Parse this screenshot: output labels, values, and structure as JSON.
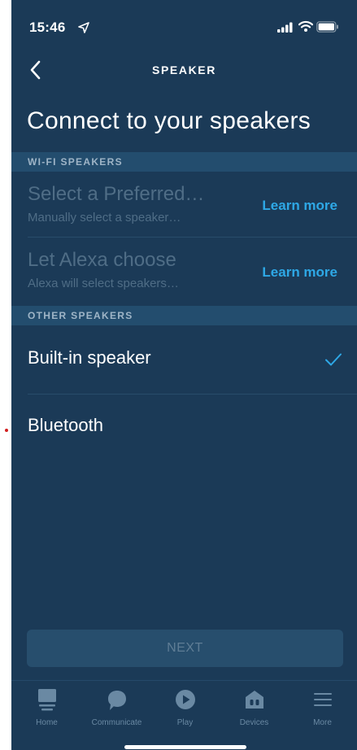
{
  "status": {
    "time": "15:46"
  },
  "header": {
    "title": "SPEAKER"
  },
  "page": {
    "title": "Connect to your speakers"
  },
  "wifi_section": {
    "label": "WI-FI SPEAKERS",
    "items": [
      {
        "title": "Select a Preferred…",
        "subtitle": "Manually select a speaker…",
        "action": "Learn more"
      },
      {
        "title": "Let Alexa choose",
        "subtitle": "Alexa will select speakers…",
        "action": "Learn more"
      }
    ]
  },
  "other_section": {
    "label": "OTHER SPEAKERS",
    "items": [
      {
        "label": "Built-in speaker",
        "selected": true
      },
      {
        "label": "Bluetooth",
        "selected": false
      }
    ]
  },
  "next_label": "NEXT",
  "tabs": [
    {
      "label": "Home",
      "icon": "home-icon"
    },
    {
      "label": "Communicate",
      "icon": "chat-bubble-icon"
    },
    {
      "label": "Play",
      "icon": "play-icon"
    },
    {
      "label": "Devices",
      "icon": "devices-icon"
    },
    {
      "label": "More",
      "icon": "menu-icon"
    }
  ],
  "colors": {
    "background": "#1b3a57",
    "section_header": "#234d6e",
    "accent": "#2ea8e6",
    "disabled_text": "#4f6d86"
  }
}
